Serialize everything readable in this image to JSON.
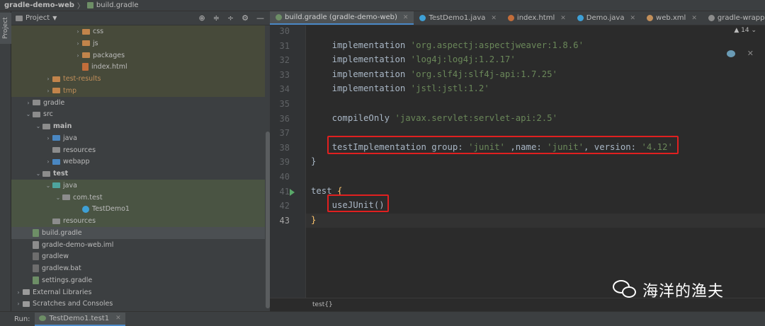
{
  "titlebar": {
    "project": "gradle-demo-web",
    "separator": "〉",
    "file": "build.gradle"
  },
  "left_strip": {
    "tab": "Project"
  },
  "project_panel": {
    "title": "Project",
    "tools": {
      "locate": "⊕",
      "collapse": "≑",
      "expand": "÷",
      "settings": "⚙",
      "hide": "—"
    },
    "tree": [
      {
        "label": "css",
        "indent": 6,
        "kind": "folder",
        "color": "orange",
        "arrow": "›",
        "bg": "olive"
      },
      {
        "label": "js",
        "indent": 6,
        "kind": "folder",
        "color": "orange",
        "arrow": "›",
        "bg": "olive"
      },
      {
        "label": "packages",
        "indent": 6,
        "kind": "folder",
        "color": "orange",
        "arrow": "›",
        "bg": "olive"
      },
      {
        "label": "index.html",
        "indent": 6,
        "kind": "html",
        "arrow": "",
        "bg": "olive"
      },
      {
        "label": "test-results",
        "indent": 3,
        "kind": "folder",
        "color": "orange",
        "arrow": "›",
        "bg": "olive",
        "orange": true
      },
      {
        "label": "tmp",
        "indent": 3,
        "kind": "folder",
        "color": "orange",
        "arrow": "›",
        "bg": "olive",
        "orange": true
      },
      {
        "label": "gradle",
        "indent": 1,
        "kind": "folder",
        "color": "grey",
        "arrow": "›",
        "bg": ""
      },
      {
        "label": "src",
        "indent": 1,
        "kind": "folder",
        "color": "grey",
        "arrow": "⌄",
        "bg": ""
      },
      {
        "label": "main",
        "indent": 2,
        "kind": "folder",
        "color": "grey",
        "arrow": "⌄",
        "bg": "",
        "bold": true
      },
      {
        "label": "java",
        "indent": 3,
        "kind": "folder",
        "color": "blue",
        "arrow": "›",
        "bg": ""
      },
      {
        "label": "resources",
        "indent": 3,
        "kind": "folder",
        "color": "grey",
        "arrow": "",
        "bg": ""
      },
      {
        "label": "webapp",
        "indent": 3,
        "kind": "folder",
        "color": "blue",
        "arrow": "›",
        "bg": ""
      },
      {
        "label": "test",
        "indent": 2,
        "kind": "folder",
        "color": "grey",
        "arrow": "⌄",
        "bg": "",
        "bold": true
      },
      {
        "label": "java",
        "indent": 3,
        "kind": "folder",
        "color": "teal",
        "arrow": "⌄",
        "bg": "green"
      },
      {
        "label": "com.test",
        "indent": 4,
        "kind": "folder",
        "color": "grey",
        "arrow": "⌄",
        "bg": "green"
      },
      {
        "label": "TestDemo1",
        "indent": 6,
        "kind": "java",
        "arrow": "",
        "bg": "green"
      },
      {
        "label": "resources",
        "indent": 3,
        "kind": "folder",
        "color": "grey",
        "arrow": "",
        "bg": "green"
      },
      {
        "label": "build.gradle",
        "indent": 1,
        "kind": "gradle",
        "arrow": "",
        "bg": "sel"
      },
      {
        "label": "gradle-demo-web.iml",
        "indent": 1,
        "kind": "iml",
        "arrow": "",
        "bg": ""
      },
      {
        "label": "gradlew",
        "indent": 1,
        "kind": "sh",
        "arrow": "",
        "bg": ""
      },
      {
        "label": "gradlew.bat",
        "indent": 1,
        "kind": "sh",
        "arrow": "",
        "bg": ""
      },
      {
        "label": "settings.gradle",
        "indent": 1,
        "kind": "gradle",
        "arrow": "",
        "bg": ""
      },
      {
        "label": "External Libraries",
        "indent": 0,
        "kind": "libs",
        "arrow": "›",
        "bg": ""
      },
      {
        "label": "Scratches and Consoles",
        "indent": 0,
        "kind": "libs",
        "arrow": "›",
        "bg": ""
      }
    ]
  },
  "tabs": [
    {
      "label": "build.gradle (gradle-demo-web)",
      "icon_color": "#6d8e66",
      "active": true
    },
    {
      "label": "TestDemo1.java",
      "icon_color": "#3ea0d6",
      "active": false
    },
    {
      "label": "index.html",
      "icon_color": "#c26d3a",
      "active": false
    },
    {
      "label": "Demo.java",
      "icon_color": "#3ea0d6",
      "active": false
    },
    {
      "label": "web.xml",
      "icon_color": "#c28f5a",
      "active": false
    },
    {
      "label": "gradle-wrapper.properties",
      "icon_color": "#8c8c8c",
      "active": false
    }
  ],
  "editor": {
    "hint": "▲ 14 ⌄",
    "lines": [
      {
        "n": "30",
        "tokens": []
      },
      {
        "n": "31",
        "tokens": [
          {
            "t": "    implementation ",
            "c": "ident"
          },
          {
            "t": "'org.aspectj:aspectjweaver:1.8.6'",
            "c": "str"
          }
        ]
      },
      {
        "n": "32",
        "tokens": [
          {
            "t": "    implementation ",
            "c": "ident"
          },
          {
            "t": "'log4j:log4j:1.2.17'",
            "c": "str"
          }
        ]
      },
      {
        "n": "33",
        "tokens": [
          {
            "t": "    implementation ",
            "c": "ident"
          },
          {
            "t": "'org.slf4j:slf4j-api:1.7.25'",
            "c": "str"
          }
        ]
      },
      {
        "n": "34",
        "tokens": [
          {
            "t": "    implementation ",
            "c": "ident"
          },
          {
            "t": "'jstl:jstl:1.2'",
            "c": "str"
          }
        ]
      },
      {
        "n": "35",
        "tokens": []
      },
      {
        "n": "36",
        "tokens": [
          {
            "t": "    compileOnly ",
            "c": "ident"
          },
          {
            "t": "'javax.servlet:servlet-api:2.5'",
            "c": "str"
          }
        ]
      },
      {
        "n": "37",
        "tokens": []
      },
      {
        "n": "38",
        "tokens": [
          {
            "t": "    testImplementation group: ",
            "c": "ident"
          },
          {
            "t": "'junit'",
            "c": "str"
          },
          {
            "t": " ,name: ",
            "c": "ident"
          },
          {
            "t": "'junit'",
            "c": "str"
          },
          {
            "t": ", version: ",
            "c": "ident"
          },
          {
            "t": "'4.12'",
            "c": "str"
          }
        ]
      },
      {
        "n": "39",
        "tokens": [
          {
            "t": "}",
            "c": "ident"
          }
        ]
      },
      {
        "n": "40",
        "tokens": []
      },
      {
        "n": "41",
        "tokens": [
          {
            "t": "test ",
            "c": "ident"
          },
          {
            "t": "{",
            "c": "fn"
          }
        ],
        "run": true
      },
      {
        "n": "42",
        "tokens": [
          {
            "t": "    useJUnit()",
            "c": "ident"
          }
        ]
      },
      {
        "n": "43",
        "tokens": [
          {
            "t": "}",
            "c": "fn"
          }
        ],
        "current": true
      }
    ]
  },
  "breadcrumbs": {
    "path": "test{}"
  },
  "statusbar": {
    "run_label": "Run:",
    "run_tab": "TestDemo1.test1"
  },
  "watermark": {
    "text": "海洋的渔夫"
  }
}
